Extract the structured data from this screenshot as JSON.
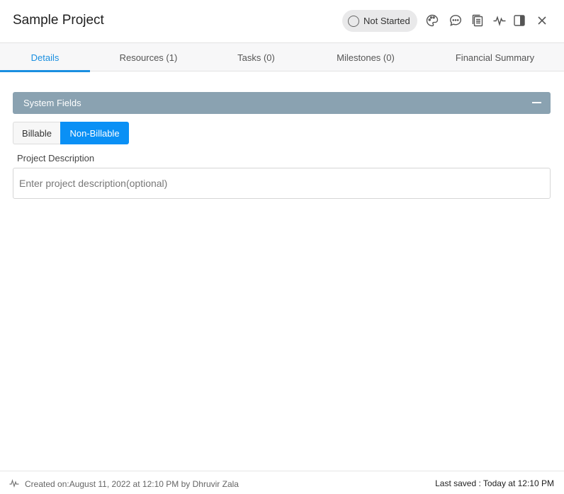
{
  "header": {
    "title": "Sample Project",
    "status": "Not Started",
    "icons": [
      "palette-icon",
      "comment-icon",
      "copy-icon",
      "activity-icon",
      "panel-icon",
      "close-icon"
    ]
  },
  "tabs": [
    {
      "label": "Details",
      "active": true
    },
    {
      "label": "Resources (1)",
      "active": false
    },
    {
      "label": "Tasks (0)",
      "active": false
    },
    {
      "label": "Milestones (0)",
      "active": false
    },
    {
      "label": "Financial Summary",
      "active": false
    }
  ],
  "section": {
    "title": "System Fields"
  },
  "billing_toggle": {
    "options": [
      "Billable",
      "Non-Billable"
    ],
    "selected": "Non-Billable"
  },
  "description": {
    "label": "Project Description",
    "placeholder": "Enter project description(optional)",
    "value": ""
  },
  "footer": {
    "created": "Created on:August 11, 2022 at 12:10 PM by Dhruvir Zala",
    "last_saved": "Last saved : Today at 12:10 PM"
  },
  "colors": {
    "accent": "#1a8fe0",
    "section_bar": "#8aa2b1",
    "toggle_active": "#0a90f5"
  }
}
